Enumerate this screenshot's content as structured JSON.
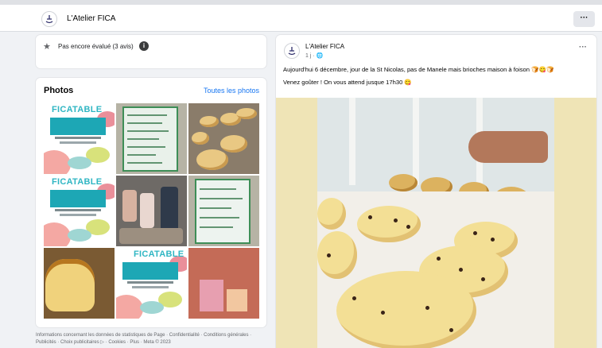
{
  "header": {
    "page_name": "L'Atelier FICA",
    "more_label": "···"
  },
  "rating": {
    "text": "Pas encore évalué (3 avis)",
    "info_glyph": "i"
  },
  "photos": {
    "title": "Photos",
    "see_all": "Toutes les photos",
    "poster_title": "FICATABLE"
  },
  "footer": {
    "text": "Informations concernant les données de statistiques de Page · Confidentialité · Conditions générales · Publicités · Choix publicitaires ▷ · Cookies · Plus · Meta © 2023"
  },
  "post": {
    "author": "L'Atelier FICA",
    "date": "1 j · 🌐",
    "more_label": "···",
    "text_line1": "Aujourd'hui 6 décembre, jour de la St Nicolas, pas de Manele mais brioches maison à foison 🍞😋🍞",
    "text_line2": "Venez goûter ! On vous attend jusque 17h30 😋"
  },
  "colors": {
    "link": "#1877f2",
    "accent_teal": "#1da7b5"
  }
}
